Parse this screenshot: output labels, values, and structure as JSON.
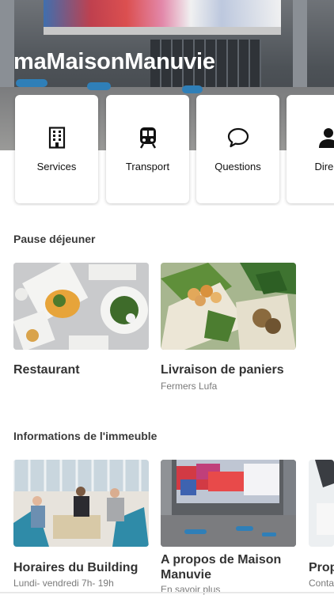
{
  "header": {
    "title": "maMaisonManuvie"
  },
  "quick_links": [
    {
      "label": "Services",
      "icon": "building-icon"
    },
    {
      "label": "Transport",
      "icon": "train-icon"
    },
    {
      "label": "Questions",
      "icon": "speech-bubble-icon"
    },
    {
      "label": "Direct",
      "icon": "person-icon"
    }
  ],
  "lunch": {
    "heading": "Pause déjeuner",
    "items": [
      {
        "title": "Restaurant",
        "subtitle": ""
      },
      {
        "title": "Livraison de paniers",
        "subtitle": "Fermers Lufa"
      }
    ]
  },
  "building": {
    "heading": "Informations de l'immeuble",
    "items": [
      {
        "title": "Horaires du Building",
        "subtitle": "Lundi- vendredi 7h- 19h"
      },
      {
        "title": "A propos de Maison Manuvie",
        "subtitle": "En savoir plus"
      },
      {
        "title": "Prop",
        "subtitle": "Conta"
      }
    ]
  },
  "colors": {
    "hero_overlay": "#4d5257",
    "accent_blue": "#2f7fb8",
    "card_bg": "#ffffff"
  }
}
